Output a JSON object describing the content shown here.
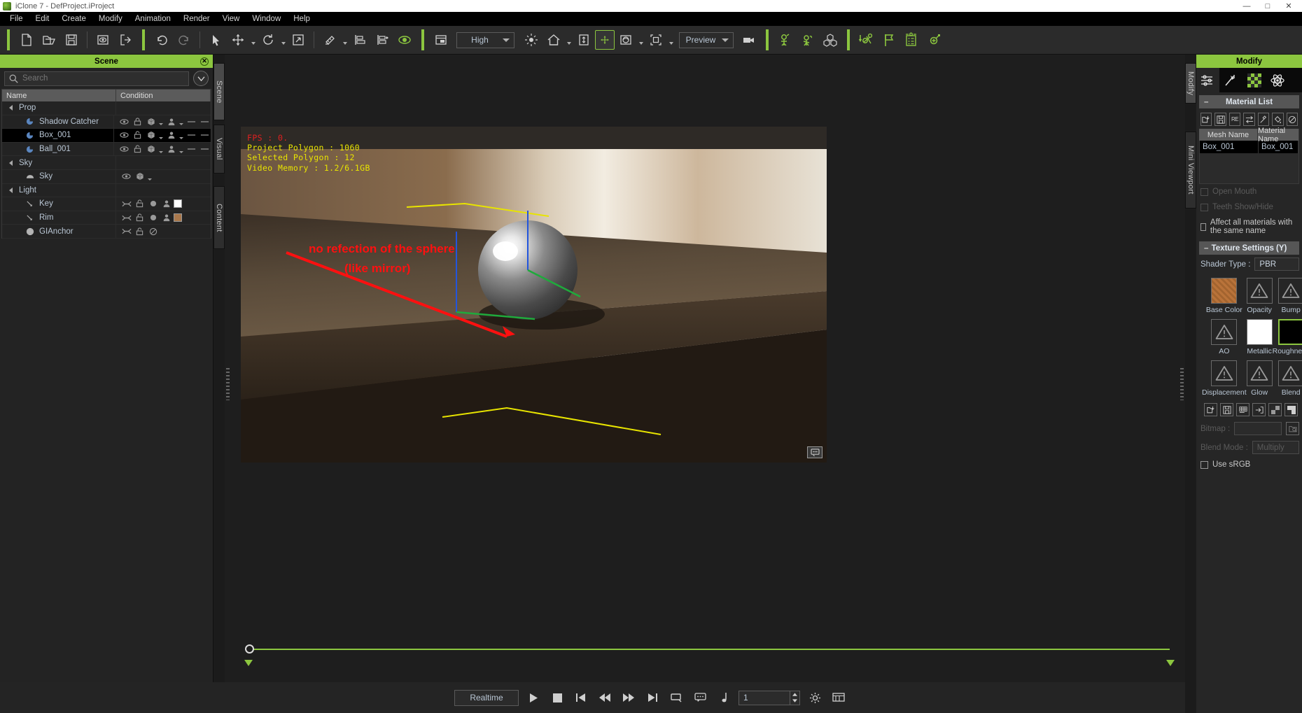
{
  "window": {
    "title": "iClone 7 - DefProject.iProject",
    "minimize": "—",
    "maximize": "□",
    "close": "✕"
  },
  "menu": [
    "File",
    "Edit",
    "Create",
    "Modify",
    "Animation",
    "Render",
    "View",
    "Window",
    "Help"
  ],
  "toolbar": {
    "quality_value": "High",
    "preview_value": "Preview",
    "icons": [
      "new-file-icon",
      "open-folder-icon",
      "save-icon",
      "preview-project-icon",
      "export-icon",
      "undo-icon",
      "redo-icon",
      "select-tool-icon",
      "move-tool-icon",
      "rotate-tool-icon",
      "scale-tool-icon",
      "align-tool-icon",
      "align-left-icon",
      "align-right-icon",
      "eye-icon",
      "layout-icon",
      "light-icon",
      "home-icon",
      "ground-icon",
      "transform-gizmo-icon",
      "sphere-preview-icon",
      "bounding-box-icon",
      "camera-icon",
      "pose-icon",
      "motion-icon",
      "props-icon",
      "reach-target-icon",
      "flag-icon",
      "checklist-icon",
      "spring-icon"
    ]
  },
  "scene": {
    "title": "Scene",
    "search_placeholder": "Search",
    "columns": [
      "Name",
      "Condition"
    ],
    "rows": [
      {
        "label": "Prop",
        "type": "group",
        "indent": 0,
        "selected": false,
        "icons": []
      },
      {
        "label": "Shadow Catcher",
        "type": "prop",
        "indent": 1,
        "selected": false,
        "icons": [
          "eye-icon",
          "lock-closed-icon",
          "mesh-icon",
          "caret",
          "person-icon",
          "caret",
          "dash",
          "dash"
        ]
      },
      {
        "label": "Box_001",
        "type": "prop",
        "indent": 1,
        "selected": true,
        "icons": [
          "eye-icon",
          "lock-open-icon",
          "mesh-icon",
          "caret",
          "person-icon",
          "caret",
          "dash",
          "dash"
        ]
      },
      {
        "label": "Ball_001",
        "type": "prop",
        "indent": 1,
        "selected": false,
        "icons": [
          "eye-icon",
          "lock-open-icon",
          "mesh-icon",
          "caret",
          "person-icon",
          "caret",
          "dash",
          "dash"
        ]
      },
      {
        "label": "Sky",
        "type": "group",
        "indent": 0,
        "selected": false,
        "icons": []
      },
      {
        "label": "Sky",
        "type": "sky",
        "indent": 1,
        "selected": false,
        "icons": [
          "eye-icon",
          "mesh-icon",
          "caret"
        ]
      },
      {
        "label": "Light",
        "type": "group",
        "indent": 0,
        "selected": false,
        "icons": []
      },
      {
        "label": "Key",
        "type": "light",
        "indent": 1,
        "selected": false,
        "icons": [
          "light-toggle-icon",
          "lock-open-icon",
          "circle-icon",
          "person-icon",
          "swatch-white"
        ]
      },
      {
        "label": "Rim",
        "type": "light",
        "indent": 1,
        "selected": false,
        "icons": [
          "light-toggle-icon",
          "lock-open-icon",
          "circle-icon",
          "person-icon",
          "swatch-tan"
        ]
      },
      {
        "label": "GIAnchor",
        "type": "anchor",
        "indent": 1,
        "selected": false,
        "icons": [
          "light-toggle-icon",
          "lock-open-icon",
          "no-entry-icon"
        ]
      }
    ]
  },
  "left_tabs": [
    {
      "label": "Scene",
      "active": true
    },
    {
      "label": "Visual",
      "active": false
    },
    {
      "label": "Content",
      "active": false
    }
  ],
  "right_tabs": [
    {
      "label": "Modify",
      "active": true
    },
    {
      "label": "Mini Viewport",
      "active": false
    }
  ],
  "viewport": {
    "stats": {
      "fps": "FPS : 0.",
      "project_polygon": "Project Polygon : 1060",
      "selected_polygon": "Selected Polygon : 12",
      "video_memory": "Video Memory : 1.2/6.1GB"
    },
    "annotation_line1": "no refection of the sphere",
    "annotation_line2": "(like mirror)",
    "camera_badge": "camera-view-icon"
  },
  "timeline": {
    "current_frame": "1"
  },
  "playback": {
    "mode": "Realtime",
    "buttons": [
      "play-icon",
      "stop-icon",
      "first-frame-icon",
      "prev-frame-icon",
      "next-frame-icon",
      "last-frame-icon",
      "loop-icon",
      "comment-icon",
      "note-icon"
    ],
    "settings_icon": "gear-icon",
    "timeline_icon": "timeline-icon"
  },
  "modify": {
    "title": "Modify",
    "tabs": [
      "attribute-icon",
      "animation-icon",
      "material-icon",
      "physics-icon"
    ],
    "material_list": {
      "section_title": "Material List",
      "toolbar_icons": [
        "load-material-icon",
        "save-material-icon",
        "reset-icon",
        "swap-icon",
        "eyedropper-icon",
        "paint-bucket-icon",
        "clear-icon"
      ],
      "columns": [
        "Mesh Name",
        "Material Name"
      ],
      "rows": [
        {
          "mesh": "Box_001",
          "material": "Box_001"
        }
      ]
    },
    "checkboxes": [
      {
        "label": "Open Mouth",
        "checked": false,
        "enabled": false
      },
      {
        "label": "Teeth Show/Hide",
        "checked": false,
        "enabled": false
      },
      {
        "label": "Affect all materials with the same name",
        "checked": false,
        "enabled": true
      }
    ],
    "texture_settings": {
      "section_title": "Texture Settings  (Y)",
      "shader_label": "Shader Type :",
      "shader_value": "PBR",
      "channels": [
        {
          "label": "Base Color",
          "state": "texture",
          "swatch": "#b9733a"
        },
        {
          "label": "Opacity",
          "state": "empty"
        },
        {
          "label": "Bump",
          "state": "empty"
        },
        {
          "label": "AO",
          "state": "empty"
        },
        {
          "label": "Metallic",
          "state": "white",
          "swatch": "#ffffff"
        },
        {
          "label": "Roughness",
          "state": "black",
          "swatch": "#000000",
          "selected": true
        },
        {
          "label": "Displacement",
          "state": "empty"
        },
        {
          "label": "Glow",
          "state": "empty"
        },
        {
          "label": "Blend",
          "state": "empty"
        }
      ],
      "map_toolbar_icons": [
        "load-texture-icon",
        "save-texture-icon",
        "uv-icon",
        "apply-icon",
        "checker-icon",
        "remove-icon"
      ],
      "bitmap_label": "Bitmap :",
      "bitmap_value": "",
      "blend_mode_label": "Blend Mode :",
      "blend_mode_value": "Multiply",
      "srgb_label": "Use sRGB",
      "srgb_checked": false
    }
  },
  "colors": {
    "accent": "#8cc63f",
    "panel": "#262626",
    "annotation": "#ff1010"
  }
}
